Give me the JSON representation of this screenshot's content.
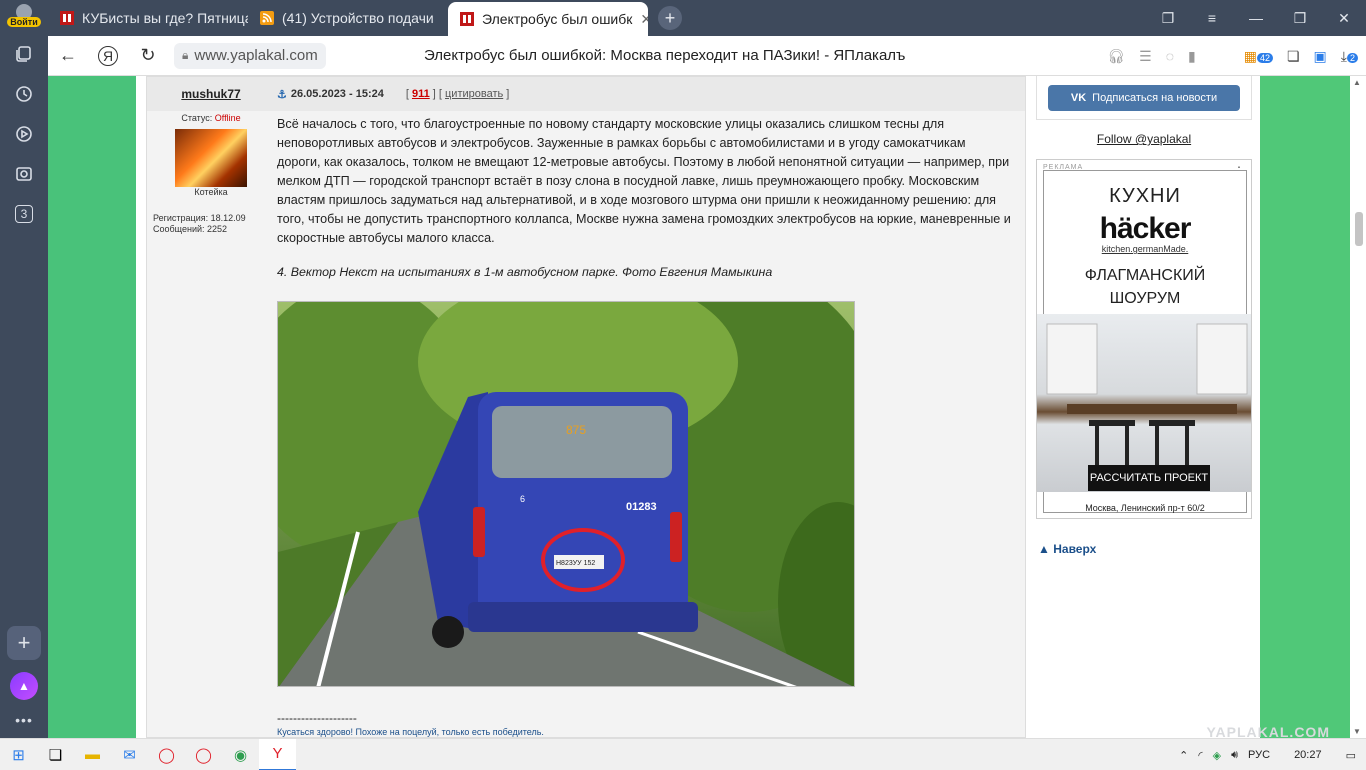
{
  "sidebar": {
    "login_label": "Войти",
    "badge_count": "3"
  },
  "tabs": [
    {
      "label": "КУБисты вы где? Пятница"
    },
    {
      "label": "(41) Устройство подачи"
    },
    {
      "label": "Электробус был ошибк",
      "active": true
    }
  ],
  "address": {
    "url": "www.yaplakal.com",
    "page_title": "Электробус был ошибкой: Москва переходит на ПАЗики! - ЯПлакалъ",
    "tool_badge": "42",
    "download_badge": "2"
  },
  "post": {
    "username": "mushuk77",
    "date": "26.05.2023 - 15:24",
    "rating": "911",
    "quote_label": "цитировать",
    "status_label": "Статус:",
    "status_value": "Offline",
    "user_title": "Котейка",
    "reg_label": "Регистрация:",
    "reg_date": "18.12.09",
    "msgs_label": "Сообщений:",
    "msgs_count": "2252",
    "text": "Всё началось с того, что благоустроенные по новому стандарту московские улицы оказались слишком тесны для неповоротливых автобусов и электробусов. Зауженные в рамках борьбы с автомобилистами и в угоду самокатчикам дороги, как оказалось, толком не вмещают 12-метровые автобусы. Поэтому в любой непонятной ситуации — например, при мелком ДТП — городской транспорт встаёт в позу слона в посудной лавке, лишь преумножающего пробку. Московским властям пришлось задуматься над альтернативой, и в ходе мозгового штурма они пришли к неожиданному решению: для того, чтобы не допустить транспортного коллапса, Москве нужна замена громоздких электробусов на юркие, маневренные и скоростные автобусы малого класса.",
    "caption": "4. Вектор Некст на испытаниях в 1-м автобусном парке. Фото Евгения Мамыкина",
    "photo": {
      "route": "875",
      "fleet_no": "01283",
      "side_no": "6",
      "plate": "Н823УУ 152"
    },
    "sig_line": "--------------------",
    "signature": "Кусаться здорово! Похоже на поцелуй, только есть победитель."
  },
  "right": {
    "vk_button": "Подписаться на новости",
    "follow": "Follow @yaplakal",
    "ad": {
      "label": "РЕКЛАМА",
      "line1": "КУХНИ",
      "brand": "häcker",
      "brand_sub": "kitchen.germanMade.",
      "line2": "ФЛАГМАНСКИЙ",
      "line3": "ШОУРУМ",
      "button": "РАССЧИТАТЬ ПРОЕКТ",
      "address": "Москва, Ленинский пр-т 60/2"
    },
    "up_link": "Наверх"
  },
  "watermark": "YAPLAKAL.COM",
  "taskbar": {
    "lang": "РУС",
    "time": "20:27"
  }
}
